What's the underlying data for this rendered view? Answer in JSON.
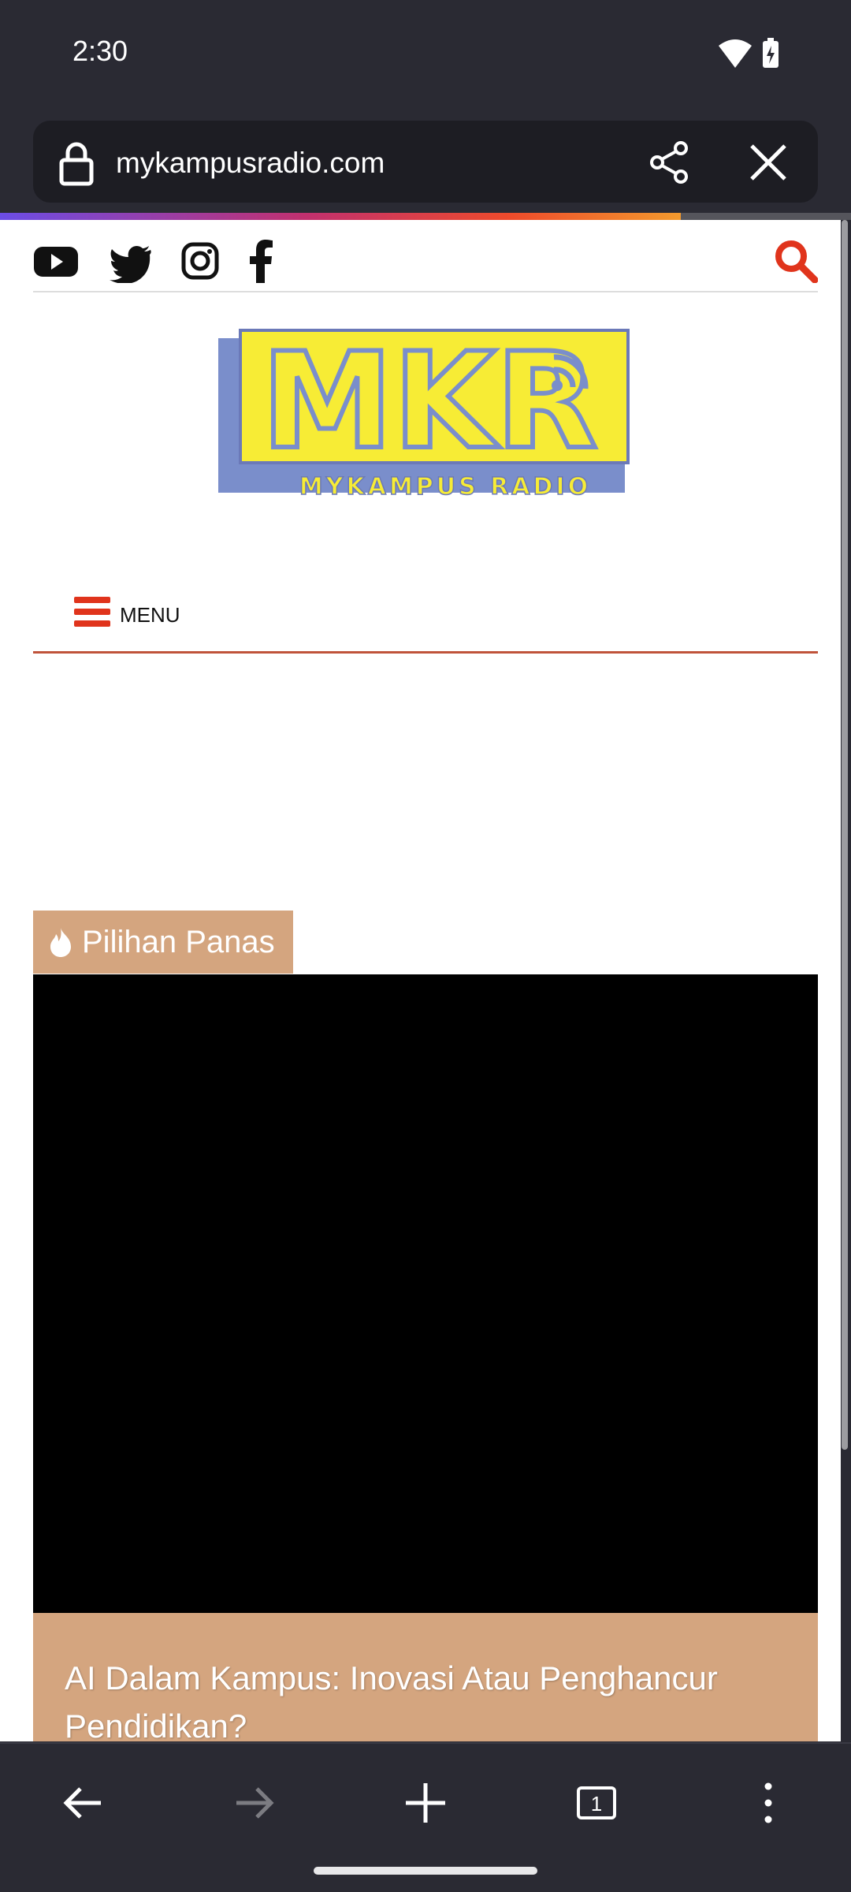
{
  "status": {
    "time": "2:30"
  },
  "urlbar": {
    "url": "mykampusradio.com"
  },
  "browser": {
    "load_progress": 0.8
  },
  "site": {
    "social": [
      "youtube",
      "twitter",
      "instagram",
      "facebook"
    ],
    "logo_text": "MYKAMPUS RADIO",
    "logo_mark": "MKR",
    "menu_label": "MENU",
    "hot_label": "Pilihan Panas",
    "article_title": "AI Dalam Kampus: Inovasi Atau Penghancur Pendidikan?"
  },
  "tabs": {
    "count": "1"
  },
  "colors": {
    "accent": "#e0341c",
    "tag_bg": "#d4a57f",
    "logo_yellow": "#f7ec35",
    "logo_blue": "#7a8ecb"
  }
}
